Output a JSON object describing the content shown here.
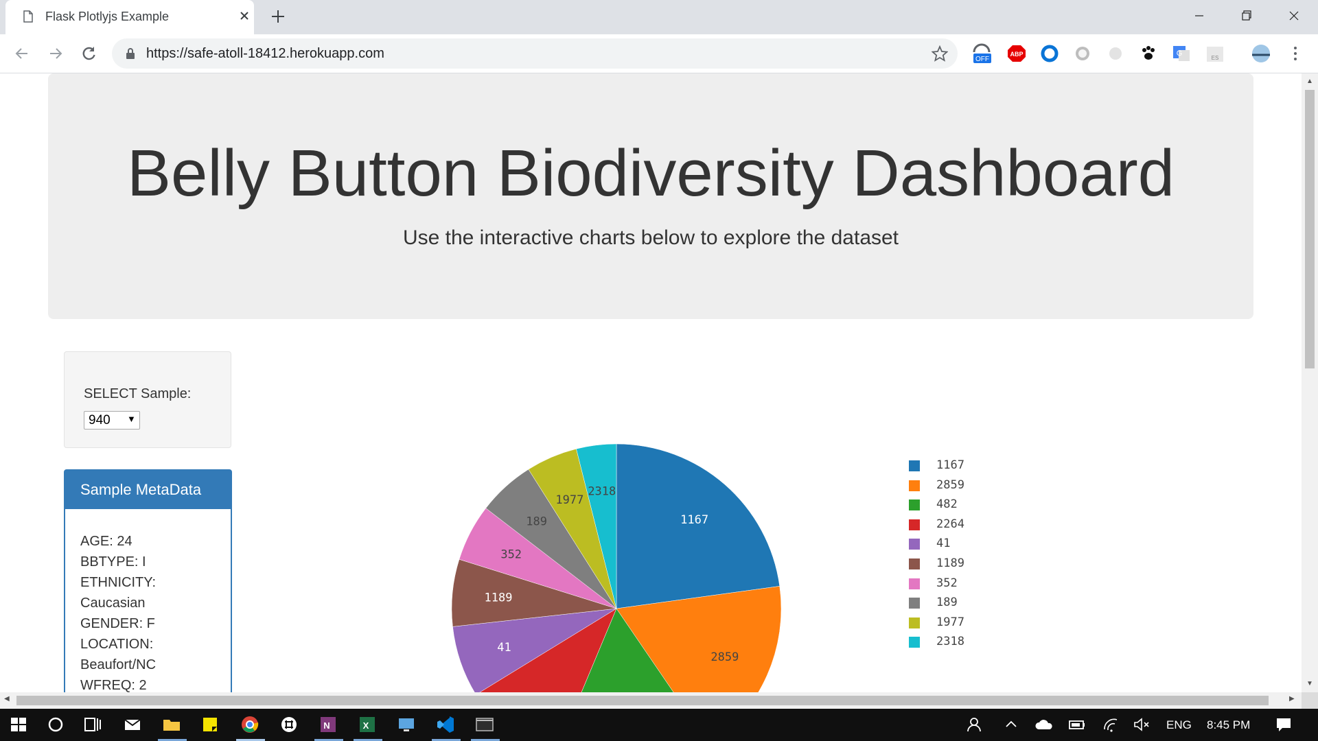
{
  "browser": {
    "tab_title": "Flask Plotlyjs Example",
    "url": "https://safe-atoll-18412.herokuapp.com",
    "extensions": [
      "off-badge-extension",
      "adblock-plus",
      "circle-extension",
      "grey-circle-extension",
      "dot-extension",
      "paw-extension",
      "google-translate-extension",
      "es-extension",
      "profile-avatar"
    ]
  },
  "header": {
    "title": "Belly Button Biodiversity Dashboard",
    "subtitle": "Use the interactive charts below to explore the dataset"
  },
  "selector": {
    "label": "SELECT Sample:",
    "value": "940"
  },
  "metadata": {
    "heading": "Sample MetaData",
    "lines": [
      "AGE: 24",
      "BBTYPE: I",
      "ETHNICITY:",
      "Caucasian",
      "GENDER: F",
      "LOCATION:",
      "Beaufort/NC",
      "WFREQ: 2"
    ]
  },
  "chart_data": {
    "type": "pie",
    "labels": [
      "1167",
      "2859",
      "482",
      "2264",
      "41",
      "1189",
      "352",
      "189",
      "1977",
      "2318"
    ],
    "values": [
      163,
      126,
      113,
      71,
      50,
      47,
      40,
      40,
      36,
      28
    ],
    "colors": [
      "#1f77b4",
      "#ff7f0e",
      "#2ca02c",
      "#d62728",
      "#9467bd",
      "#8c564b",
      "#e377c2",
      "#7f7f7f",
      "#bcbd22",
      "#17becf"
    ],
    "legend": "right",
    "sort": "descending",
    "direction": "clockwise",
    "start": "top"
  },
  "taskbar": {
    "lang": "ENG",
    "time": "8:45 PM"
  }
}
